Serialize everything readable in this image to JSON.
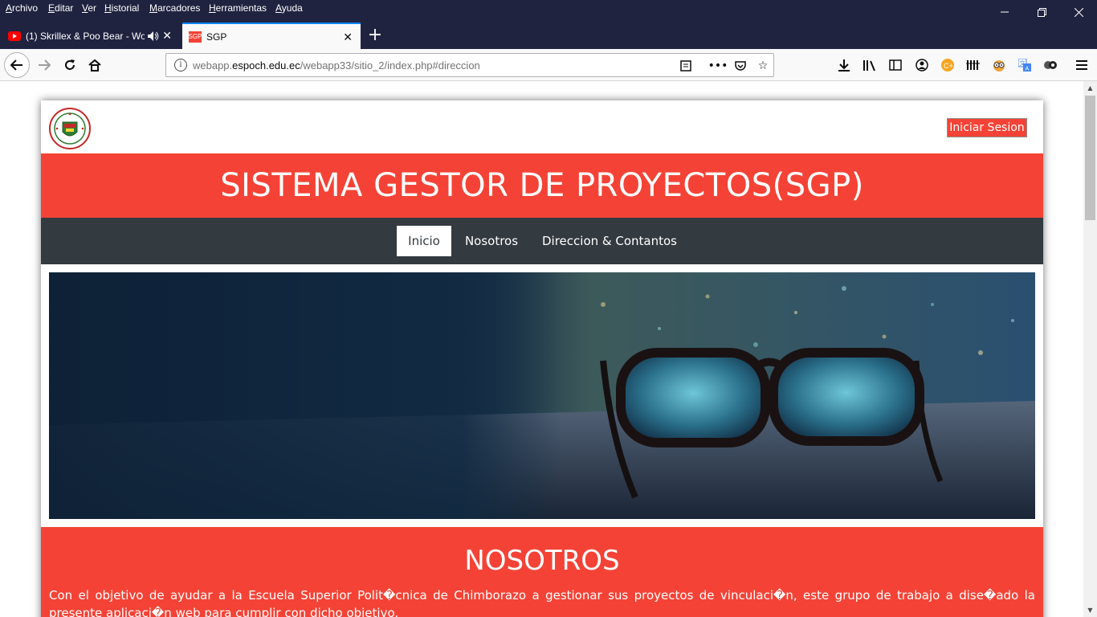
{
  "browser": {
    "menu": [
      "Archivo",
      "Editar",
      "Ver",
      "Historial",
      "Marcadores",
      "Herramientas",
      "Ayuda"
    ],
    "tabs": [
      {
        "title": "(1) Skrillex & Poo Bear - Wo",
        "favicon": "youtube-icon",
        "audio": true,
        "active": false
      },
      {
        "title": "SGP",
        "favicon": "SGP",
        "active": true
      }
    ],
    "url": {
      "prefix": "webapp.",
      "domain": "espoch.edu.ec",
      "path": "/webapp33/sitio_2/index.php#direccion"
    }
  },
  "page": {
    "login_button": "Iniciar Sesion",
    "banner_title": "SISTEMA GESTOR DE PROYECTOS(SGP)",
    "nav": [
      "Inicio",
      "Nosotros",
      "Direccion & Contantos"
    ],
    "nosotros_title": "NOSOTROS",
    "nosotros_text": "Con el objetivo de ayudar a la Escuela Superior Polit�cnica de Chimborazo a gestionar sus proyectos de vinculaci�n, este grupo de trabajo a dise�ado la presente aplicaci�n web para cumplir con dicho objetivo."
  },
  "colors": {
    "accent_red": "#f44336",
    "nav_dark": "#333a40",
    "browser_dark": "#202340",
    "tab_highlight": "#0a84ff"
  }
}
